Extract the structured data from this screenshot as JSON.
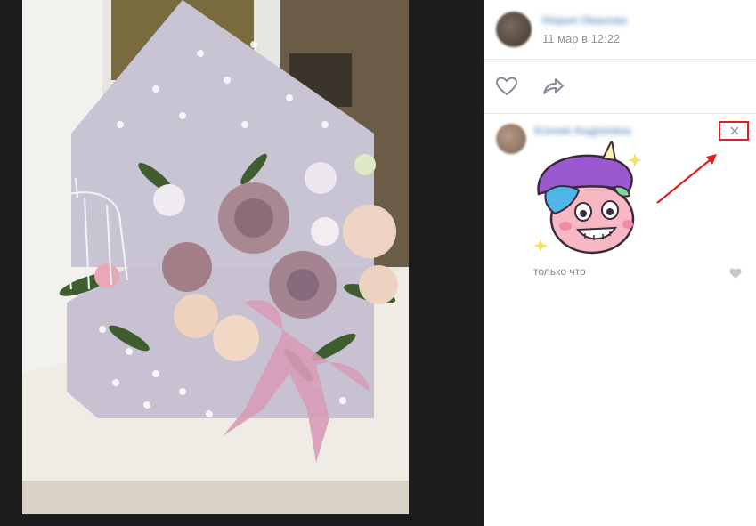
{
  "post": {
    "author_name": "Мария Иванова",
    "date": "11 мар в 12:22"
  },
  "actions": {
    "like_icon": "heart-outline-icon",
    "share_icon": "share-arrow-icon"
  },
  "comment": {
    "author_name": "Ксения Андреевна",
    "time": "только что",
    "close_icon": "close-x-icon",
    "sticker": "unicorn-sticker",
    "like_icon": "heart-icon"
  },
  "colors": {
    "link": "#5181b8",
    "muted": "#939393",
    "highlight": "#e0201e"
  }
}
